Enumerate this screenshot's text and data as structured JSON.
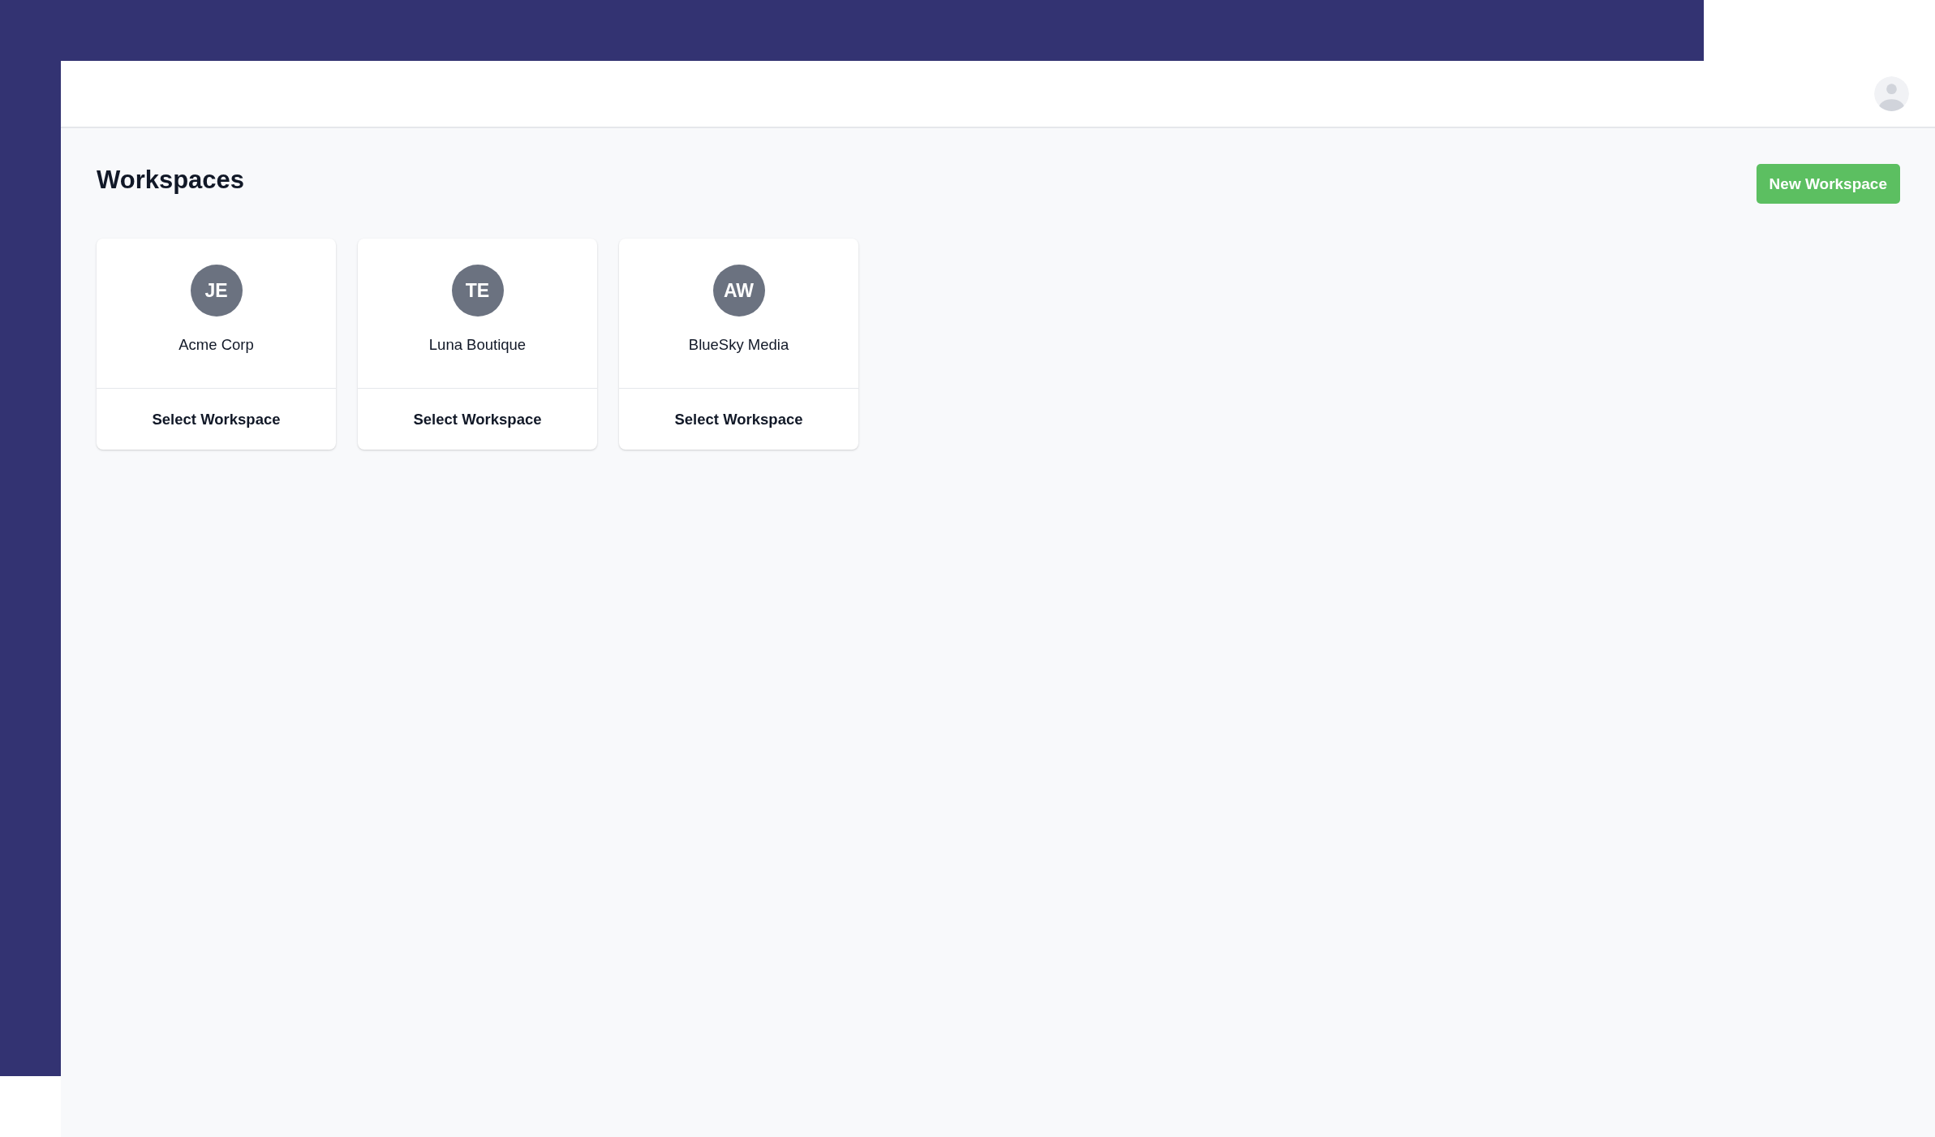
{
  "page": {
    "title": "Workspaces",
    "new_button": "New Workspace"
  },
  "workspaces": [
    {
      "initials": "JE",
      "name": "Acme Corp",
      "action": "Select Workspace"
    },
    {
      "initials": "TE",
      "name": "Luna Boutique",
      "action": "Select Workspace"
    },
    {
      "initials": "AW",
      "name": "BlueSky Media",
      "action": "Select Workspace"
    }
  ]
}
